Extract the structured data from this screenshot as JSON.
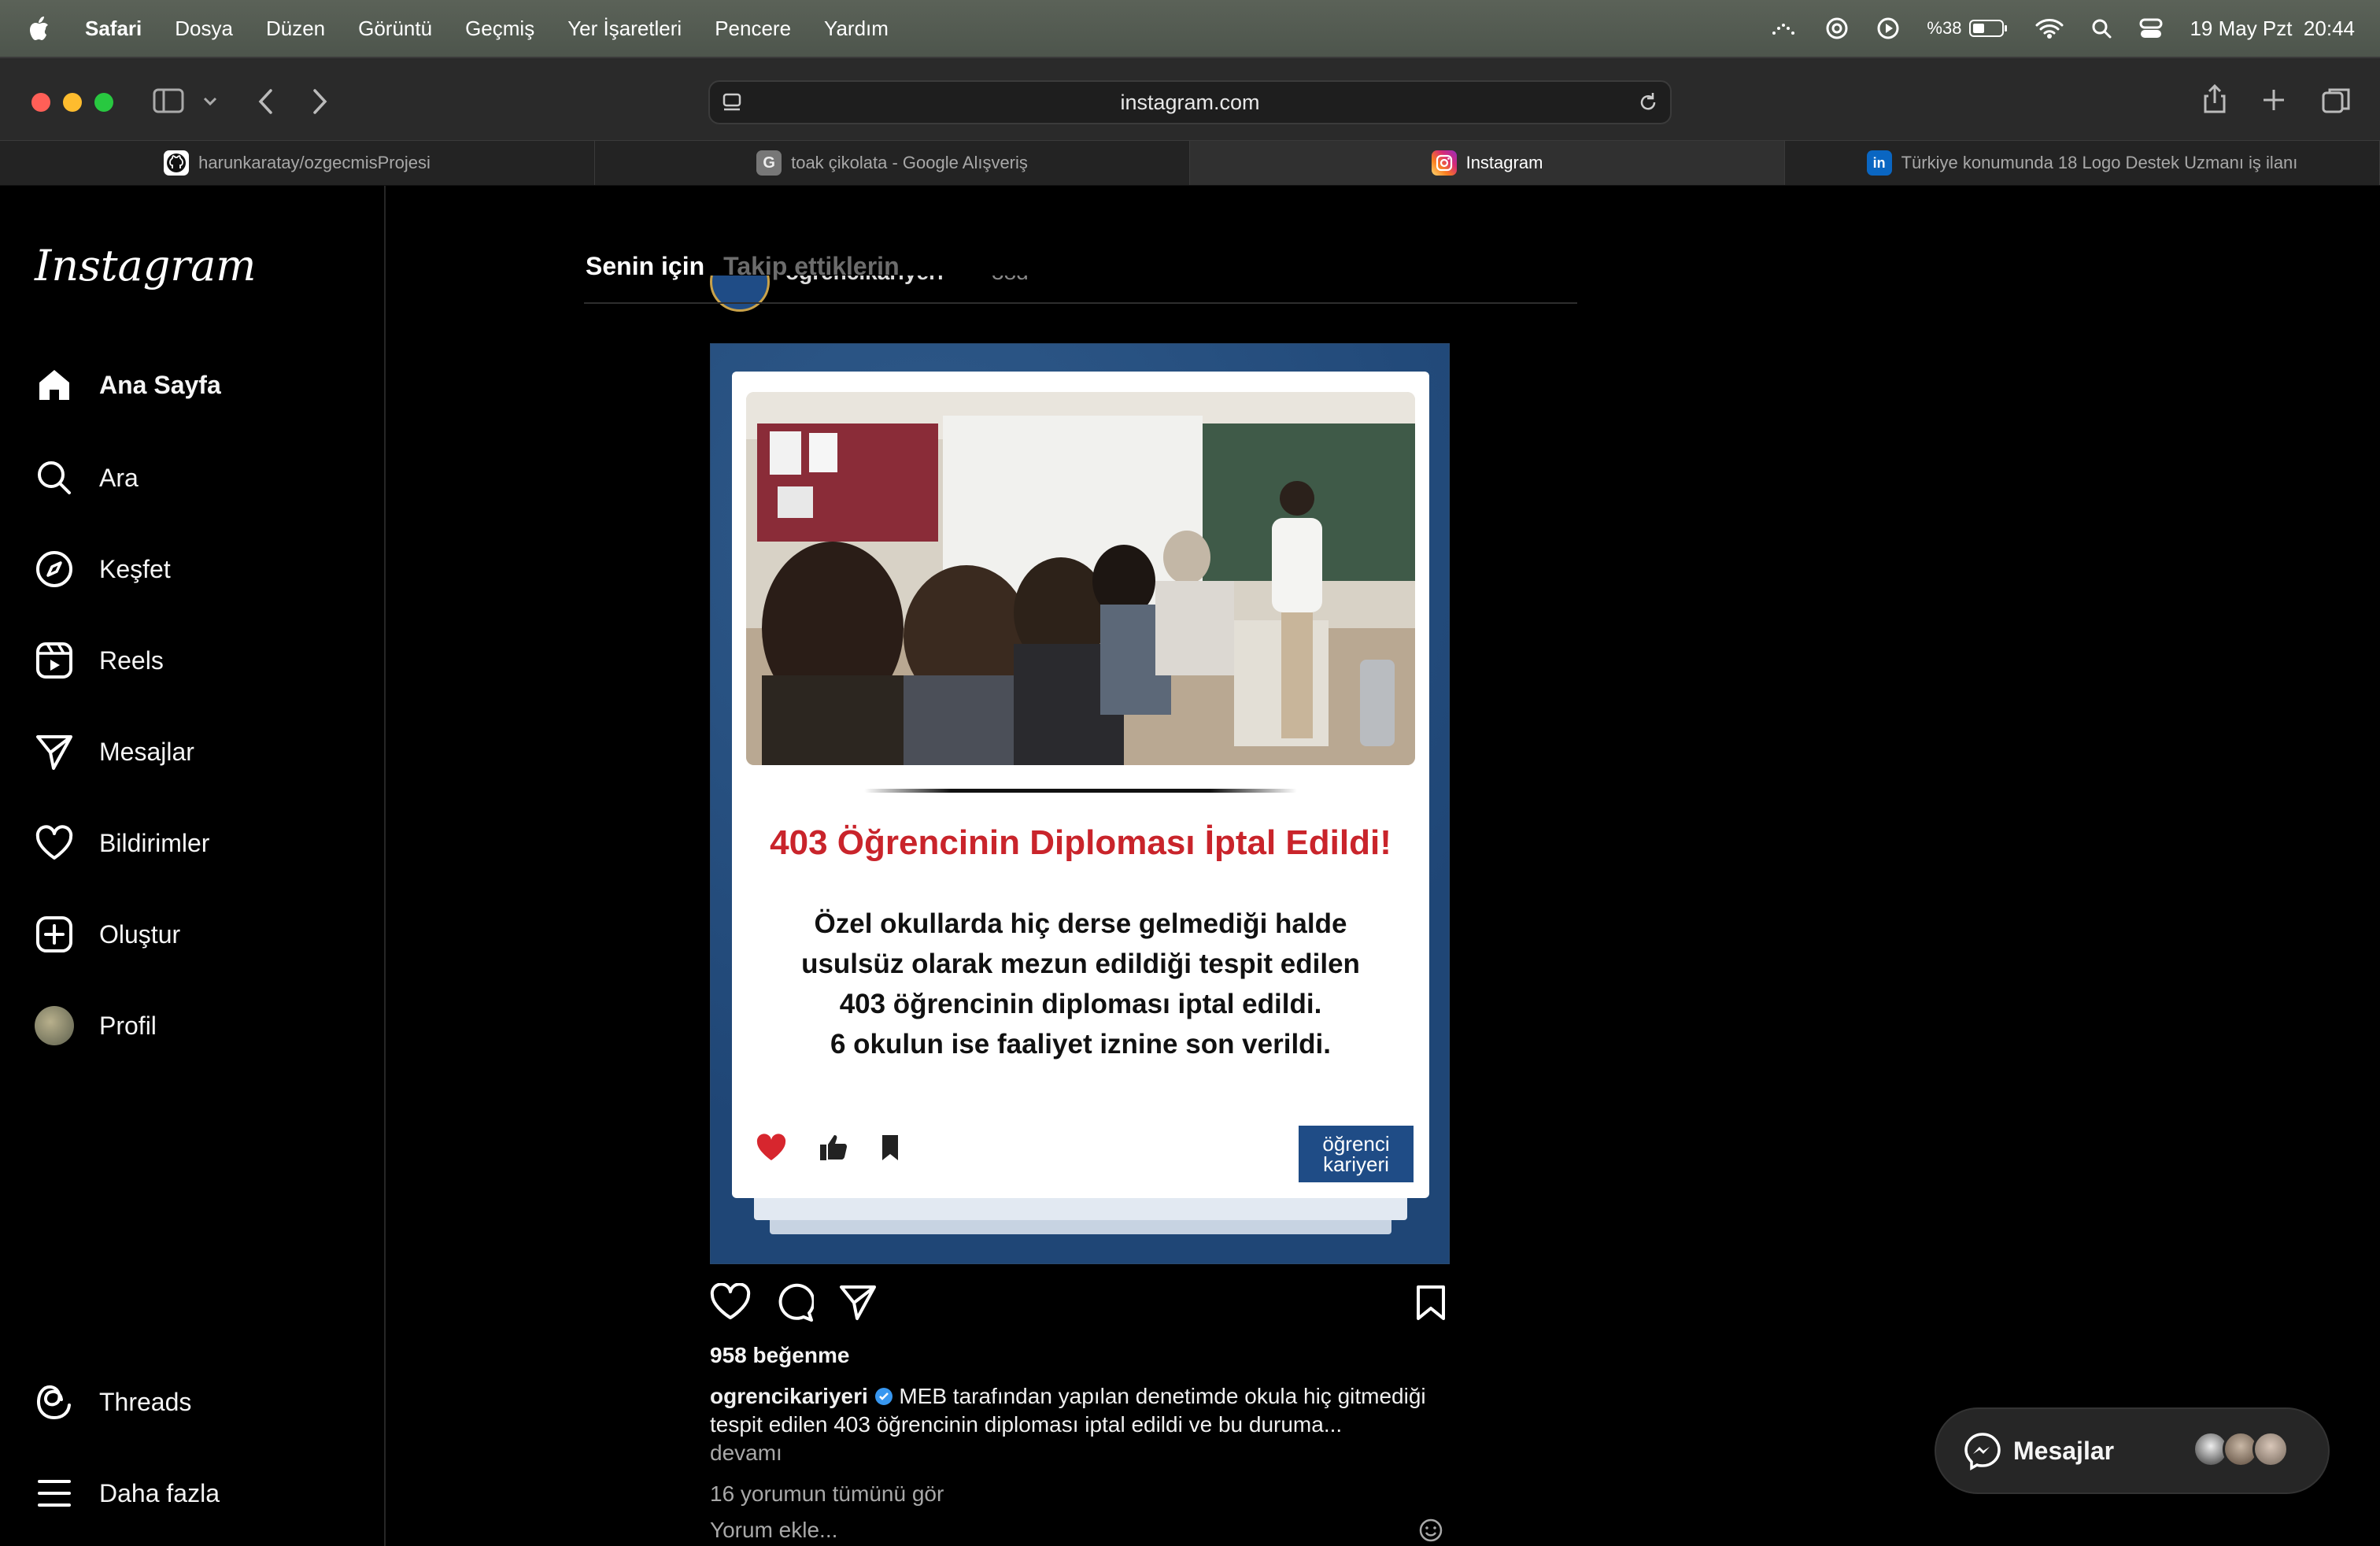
{
  "menubar": {
    "app": "Safari",
    "items": [
      "Dosya",
      "Düzen",
      "Görüntü",
      "Geçmiş",
      "Yer İşaretleri",
      "Pencere",
      "Yardım"
    ],
    "battery_pct": "%38",
    "datetime": "19 May Pzt  20:44",
    "icons": [
      "apple-icon",
      "screen-mirroring-icon",
      "chatgpt-icon",
      "play-icon",
      "battery-icon",
      "wifi-icon",
      "search-icon",
      "control-center-icon"
    ]
  },
  "toolbar": {
    "url": "instagram.com",
    "traffic_colors": [
      "#ff5f57",
      "#febc2e",
      "#28c840"
    ]
  },
  "tabs": [
    {
      "label": "harunkaratay/ozgecmisProjesi",
      "icon": "github-icon"
    },
    {
      "label": "toak çikolata - Google Alışveriş",
      "icon": "google-icon"
    },
    {
      "label": "Instagram",
      "icon": "instagram-icon"
    },
    {
      "label": "Türkiye konumunda 18 Logo Destek Uzmanı iş ilanı",
      "icon": "linkedin-icon"
    }
  ],
  "sidebar": {
    "logo": "Instagram",
    "items": [
      {
        "label": "Ana Sayfa",
        "icon": "home-icon"
      },
      {
        "label": "Ara",
        "icon": "search-icon"
      },
      {
        "label": "Keşfet",
        "icon": "compass-icon"
      },
      {
        "label": "Reels",
        "icon": "reels-icon"
      },
      {
        "label": "Mesajlar",
        "icon": "send-icon"
      },
      {
        "label": "Bildirimler",
        "icon": "heart-icon"
      },
      {
        "label": "Oluştur",
        "icon": "plus-square-icon"
      },
      {
        "label": "Profil",
        "icon": "avatar"
      }
    ],
    "bottom": [
      {
        "label": "Threads",
        "icon": "threads-icon"
      },
      {
        "label": "Daha fazla",
        "icon": "menu-icon"
      }
    ]
  },
  "feed": {
    "tab_for_you": "Senin için",
    "tab_following": "Takip ettiklerin",
    "post": {
      "header_user": "ogrencikariyeri",
      "header_time": "38d",
      "image": {
        "headline": "403 Öğrencinin Diploması İptal Edildi!",
        "body_lines": [
          "Özel okullarda hiç derse gelmediği halde",
          "usulsüz olarak mezun edildiği tespit edilen",
          "403 öğrencinin diploması iptal edildi.",
          "6 okulun ise faaliyet iznine son verildi."
        ],
        "brand_line1": "öğrenci",
        "brand_line2": "kariyeri",
        "headline_color": "#c9242b",
        "brand_color": "#1f4c86"
      },
      "likes": "958 beğenme",
      "caption_user": "ogrencikariyeri",
      "caption_text": "MEB tarafından yapılan denetimde okula hiç gitmediği tespit edilen 403 öğrencinin diploması iptal edildi ve bu duruma...",
      "caption_more": "devamı",
      "comments_link": "16 yorumun tümünü gör",
      "comment_placeholder": "Yorum ekle..."
    }
  },
  "messages_pill": {
    "label": "Mesajlar"
  }
}
